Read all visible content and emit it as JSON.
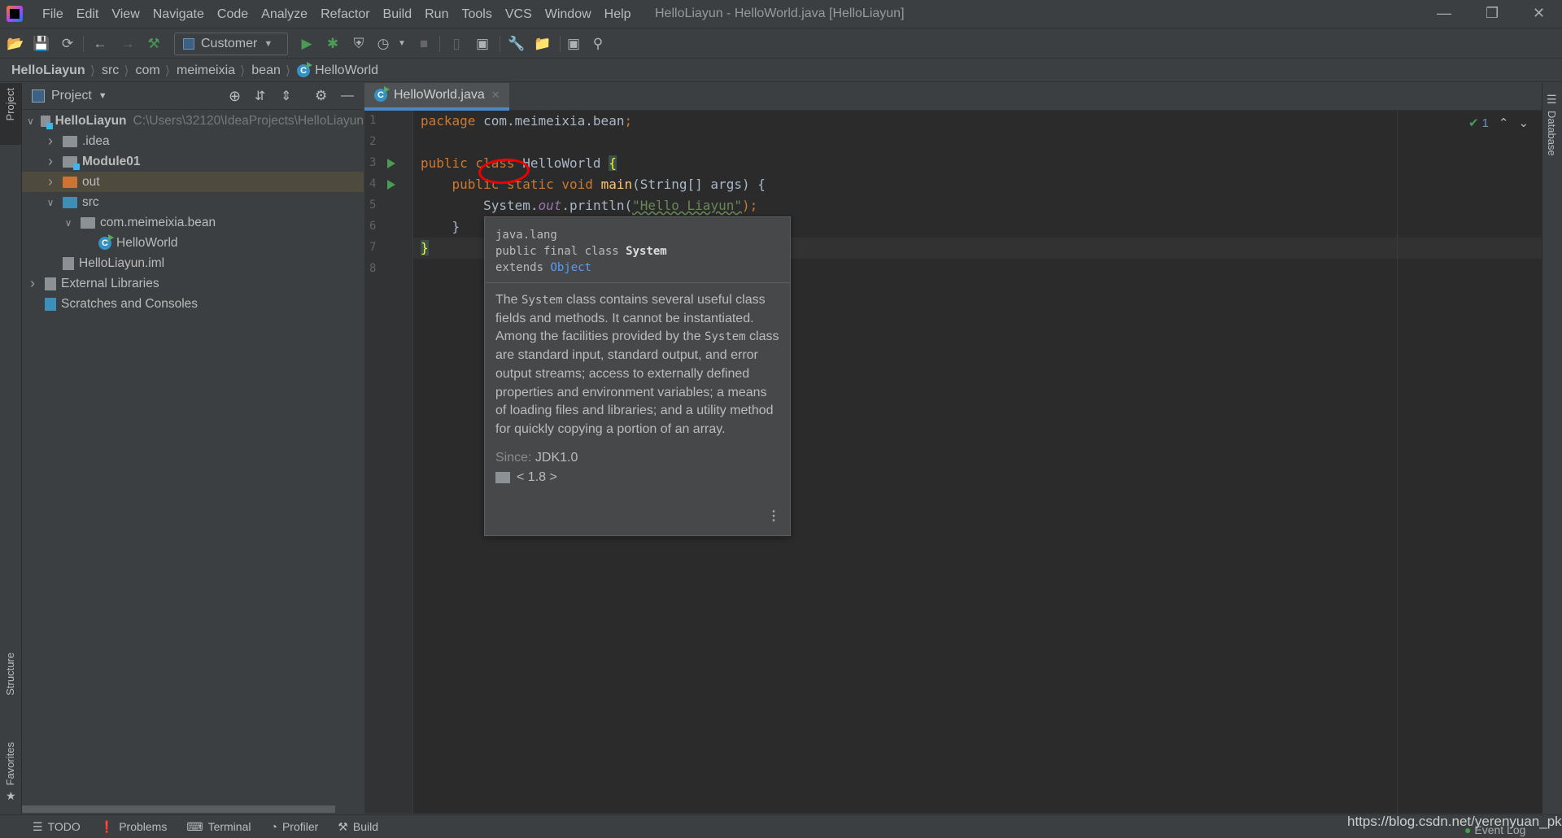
{
  "menu": [
    "File",
    "Edit",
    "View",
    "Navigate",
    "Code",
    "Analyze",
    "Refactor",
    "Build",
    "Run",
    "Tools",
    "VCS",
    "Window",
    "Help"
  ],
  "window_title": "HelloLiayun - HelloWorld.java [HelloLiayun]",
  "toolbar": {
    "run_config": "Customer"
  },
  "breadcrumb": [
    "HelloLiayun",
    "src",
    "com",
    "meimeixia",
    "bean",
    "HelloWorld"
  ],
  "project_panel": {
    "title": "Project"
  },
  "tree": [
    {
      "label": "HelloLiayun",
      "path": "C:\\Users\\32120\\IdeaProjects\\HelloLiayun",
      "depth": 0,
      "expanded": true,
      "icon": "module-folder",
      "bold": true
    },
    {
      "label": ".idea",
      "depth": 1,
      "expanded": false,
      "icon": "folder-gray"
    },
    {
      "label": "Module01",
      "depth": 1,
      "expanded": false,
      "icon": "module-folder",
      "bold": true
    },
    {
      "label": "out",
      "depth": 1,
      "expanded": false,
      "icon": "folder-orange",
      "selected": true
    },
    {
      "label": "src",
      "depth": 1,
      "expanded": true,
      "icon": "folder-blue"
    },
    {
      "label": "com.meimeixia.bean",
      "depth": 2,
      "expanded": true,
      "icon": "package"
    },
    {
      "label": "HelloWorld",
      "depth": 3,
      "icon": "java-class"
    },
    {
      "label": "HelloLiayun.iml",
      "depth": 1,
      "icon": "iml-file"
    },
    {
      "label": "External Libraries",
      "depth": 0,
      "expanded": false,
      "icon": "libraries"
    },
    {
      "label": "Scratches and Consoles",
      "depth": 0,
      "icon": "scratches"
    }
  ],
  "editor": {
    "tab": "HelloWorld.java",
    "lines": [
      [
        {
          "t": "package ",
          "c": "kw"
        },
        {
          "t": "com.meimeixia.bean",
          "c": "pl"
        },
        {
          "t": ";",
          "c": "kw"
        }
      ],
      [],
      [
        {
          "t": "public class ",
          "c": "kw"
        },
        {
          "t": "HelloWorld ",
          "c": "pl"
        },
        {
          "t": "{",
          "c": "brc"
        }
      ],
      [
        {
          "t": "    public static void ",
          "c": "kw"
        },
        {
          "t": "main",
          "c": "fn"
        },
        {
          "t": "(String[] args) {",
          "c": "pl"
        }
      ],
      [
        {
          "t": "        System.",
          "c": "pl"
        },
        {
          "t": "out",
          "c": "st"
        },
        {
          "t": ".println(",
          "c": "pl"
        },
        {
          "t": "\"Hello Liayun\"",
          "c": "str"
        },
        {
          "t": ");",
          "c": "kw"
        }
      ],
      [
        {
          "t": "    }",
          "c": "pl"
        }
      ],
      [
        {
          "t": "}",
          "c": "brc"
        }
      ],
      []
    ],
    "inspection_count": "1"
  },
  "tooltip": {
    "package": "java.lang",
    "decl_prefix": "public final class ",
    "decl_name": "System",
    "extends_kw": "extends ",
    "extends_link": "Object",
    "doc1_a": "The ",
    "doc1_code": "System",
    "doc1_b": " class contains several useful class fields and methods. It cannot be instantiated.",
    "doc2_a": "Among the facilities provided by the ",
    "doc2_code": "System",
    "doc2_b": " class are standard input, standard output, and error output streams; access to externally defined properties and environment variables; a means of loading files and libraries; and a utility method for quickly copying a portion of an array.",
    "since_label": "Since:",
    "since_value": "JDK1.0",
    "version": "< 1.8 >"
  },
  "side_tabs": {
    "project": "Project",
    "structure": "Structure",
    "favorites": "Favorites",
    "database": "Database"
  },
  "bottom_tabs": [
    "TODO",
    "Problems",
    "Terminal",
    "Profiler",
    "Build"
  ],
  "event_log": "Event Log",
  "watermark": "https://blog.csdn.net/yerenyuan_pku"
}
